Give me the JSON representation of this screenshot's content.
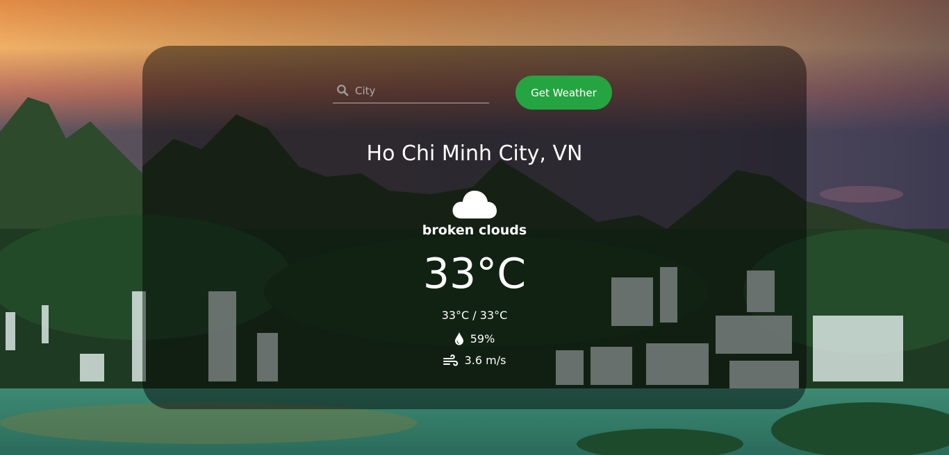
{
  "search": {
    "placeholder": "City",
    "icon": "search-icon",
    "value": ""
  },
  "actions": {
    "get_weather_label": "Get Weather",
    "button_color": "#25a442"
  },
  "weather": {
    "location": "Ho Chi Minh City, VN",
    "condition_icon": "cloud-icon",
    "description": "broken clouds",
    "temperature": "33°C",
    "min_max": "33°C / 33°C",
    "humidity": "59%",
    "humidity_icon": "water-drop-icon",
    "wind": "3.6 m/s",
    "wind_icon": "wind-icon"
  }
}
